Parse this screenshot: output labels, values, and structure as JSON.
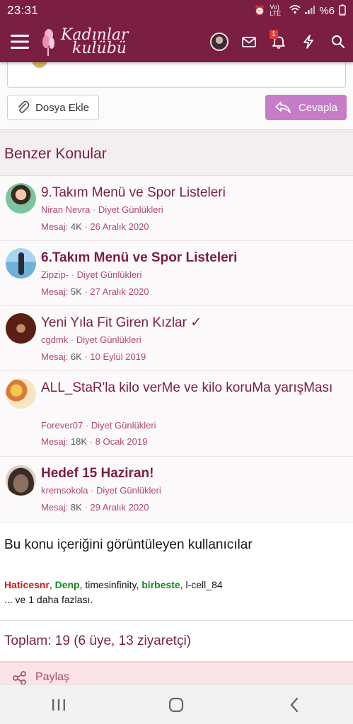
{
  "status_bar": {
    "time": "23:31",
    "network": "Vo) LTE",
    "battery": "%6"
  },
  "header": {
    "logo_line1": "Kadınlar",
    "logo_line2": "kulübü",
    "notification_count": "1"
  },
  "reply": {
    "attach_label": "Dosya Ekle",
    "reply_label": "Cevapla"
  },
  "related": {
    "heading": "Benzer Konular",
    "items": [
      {
        "title": "9.Takım Menü ve Spor Listeleri",
        "author": "Niran Nevra",
        "forum": "Diyet Günlükleri",
        "posts_label": "Mesaj:",
        "posts": "4K",
        "date": "26 Aralık 2020",
        "bold": false
      },
      {
        "title": "6.Takım Menü ve Spor Listeleri",
        "author": "Zipzip-",
        "forum": "Diyet Günlükleri",
        "posts_label": "Mesaj:",
        "posts": "5K",
        "date": "27 Aralık 2020",
        "bold": true
      },
      {
        "title": "Yeni Yıla Fit Giren Kızlar ✓",
        "author": "cgdmk",
        "forum": "Diyet Günlükleri",
        "posts_label": "Mesaj:",
        "posts": "6K",
        "date": "10 Eylül 2019",
        "bold": false
      },
      {
        "title": "ALL_StaR'la kilo verMe ve kilo koruMa yarışMası",
        "author": "Forever07",
        "forum": "Diyet Günlükleri",
        "posts_label": "Mesaj:",
        "posts": "18K",
        "date": "8 Ocak 2019",
        "bold": false
      },
      {
        "title": "Hedef 15 Haziran!",
        "author": "kremsokola",
        "forum": "Diyet Günlükleri",
        "posts_label": "Mesaj:",
        "posts": "8K",
        "date": "29 Aralık 2020",
        "bold": true
      }
    ]
  },
  "viewers": {
    "heading": "Bu konu içeriğini görüntüleyen kullanıcılar",
    "users": [
      {
        "name": "Haticesnr",
        "style": "red"
      },
      {
        "name": "Denp",
        "style": "green"
      },
      {
        "name": "timesinfinity",
        "style": "normal"
      },
      {
        "name": "birbeste",
        "style": "green"
      },
      {
        "name": "l-cell_84",
        "style": "normal"
      }
    ],
    "more": "... ve 1 daha fazlası."
  },
  "total": "Toplam: 19 (6 üye, 13 ziyaretçi)",
  "share_label": "Paylaş",
  "colors": {
    "brand": "#7a1e42",
    "reply_button": "#c77cc7",
    "link": "#b04a6c"
  },
  "icons": [
    "hamburger-icon",
    "mail-icon",
    "bell-icon",
    "bolt-icon",
    "search-icon",
    "paperclip-icon",
    "reply-icon",
    "share-icon"
  ]
}
